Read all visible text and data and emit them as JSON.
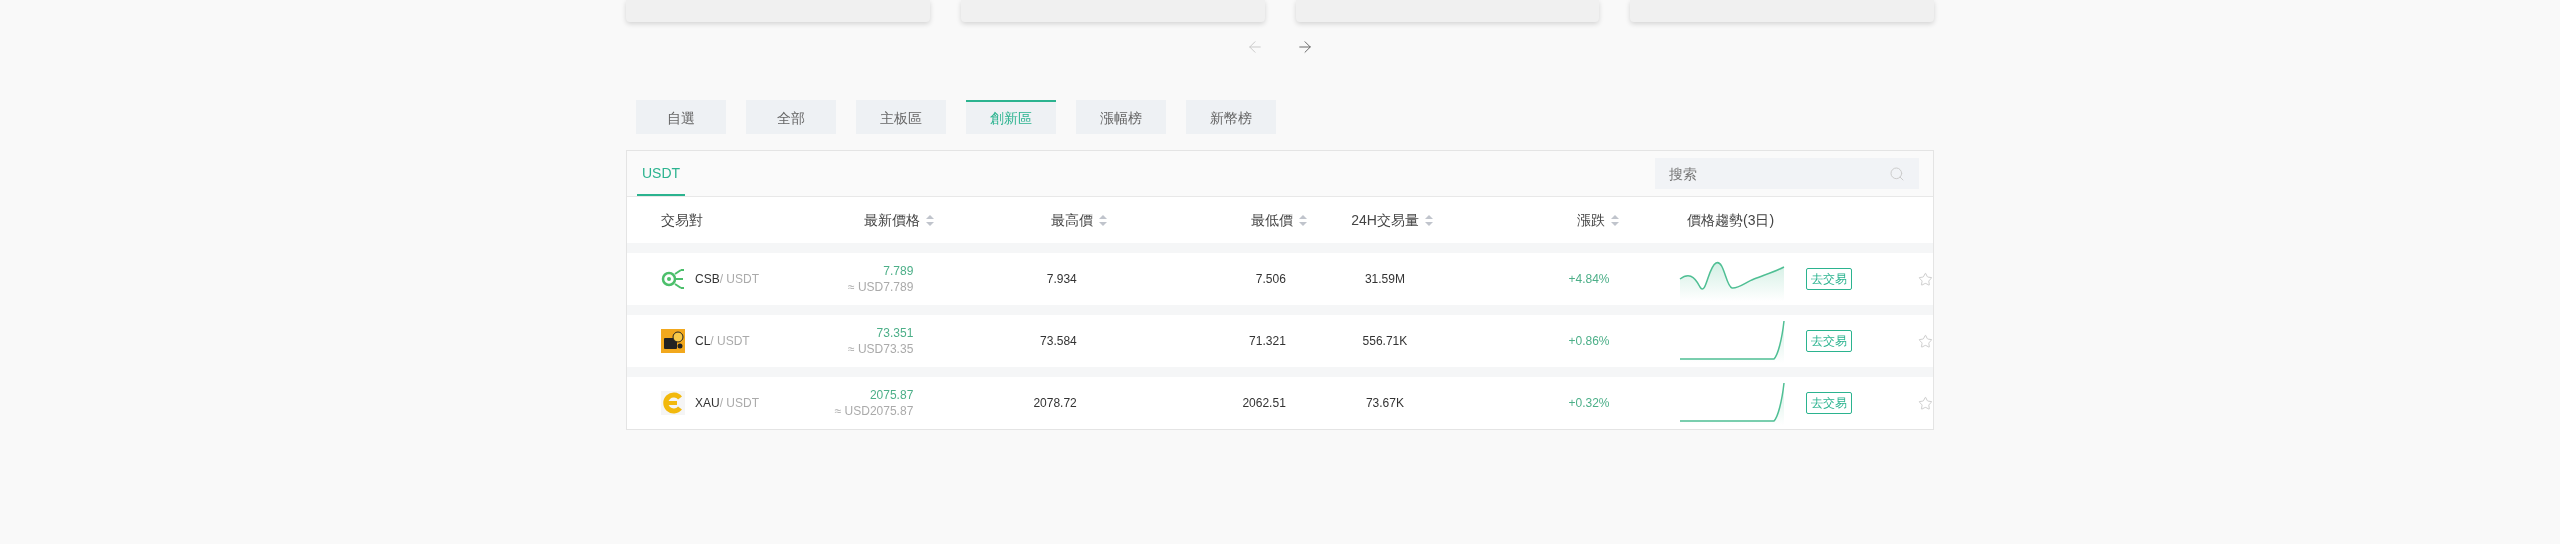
{
  "cards": [
    {
      "kind": "card"
    },
    {
      "kind": "card"
    },
    {
      "kind": "card"
    },
    {
      "kind": "card"
    }
  ],
  "carousel": {
    "prev": {
      "disabled": true
    },
    "next": {
      "disabled": false
    }
  },
  "tabs": [
    {
      "label": "自選",
      "selected": false
    },
    {
      "label": "全部",
      "selected": false
    },
    {
      "label": "主板區",
      "selected": false
    },
    {
      "label": "創新區",
      "selected": true
    },
    {
      "label": "漲幅榜",
      "selected": false
    },
    {
      "label": "新幣榜",
      "selected": false
    }
  ],
  "market_tabs": [
    {
      "label": "USDT",
      "selected": true
    }
  ],
  "search": {
    "placeholder": "搜索"
  },
  "columns": [
    {
      "label": "交易對",
      "sortable": false
    },
    {
      "label": "最新價格",
      "sortable": true
    },
    {
      "label": "最高價",
      "sortable": true
    },
    {
      "label": "最低價",
      "sortable": true
    },
    {
      "label": "24H交易量",
      "sortable": true
    },
    {
      "label": "漲跌",
      "sortable": true
    },
    {
      "label": "價格趨勢(3日)",
      "sortable": false
    }
  ],
  "rows": [
    {
      "base": "CSB",
      "quote": "/ USDT",
      "price": "7.789",
      "price_usd": "≈ USD7.789",
      "high": "7.934",
      "low": "7.506",
      "volume": "31.59M",
      "change": "+4.84%",
      "action": "去交易",
      "favorite": false
    },
    {
      "base": "CL",
      "quote": "/ USDT",
      "price": "73.351",
      "price_usd": "≈ USD73.35",
      "high": "73.584",
      "low": "71.321",
      "volume": "556.71K",
      "change": "+0.86%",
      "action": "去交易",
      "favorite": false
    },
    {
      "base": "XAU",
      "quote": "/ USDT",
      "price": "2075.87",
      "price_usd": "≈ USD2075.87",
      "high": "2078.72",
      "low": "2062.51",
      "volume": "73.67K",
      "change": "+0.32%",
      "action": "去交易",
      "favorite": false
    }
  ]
}
